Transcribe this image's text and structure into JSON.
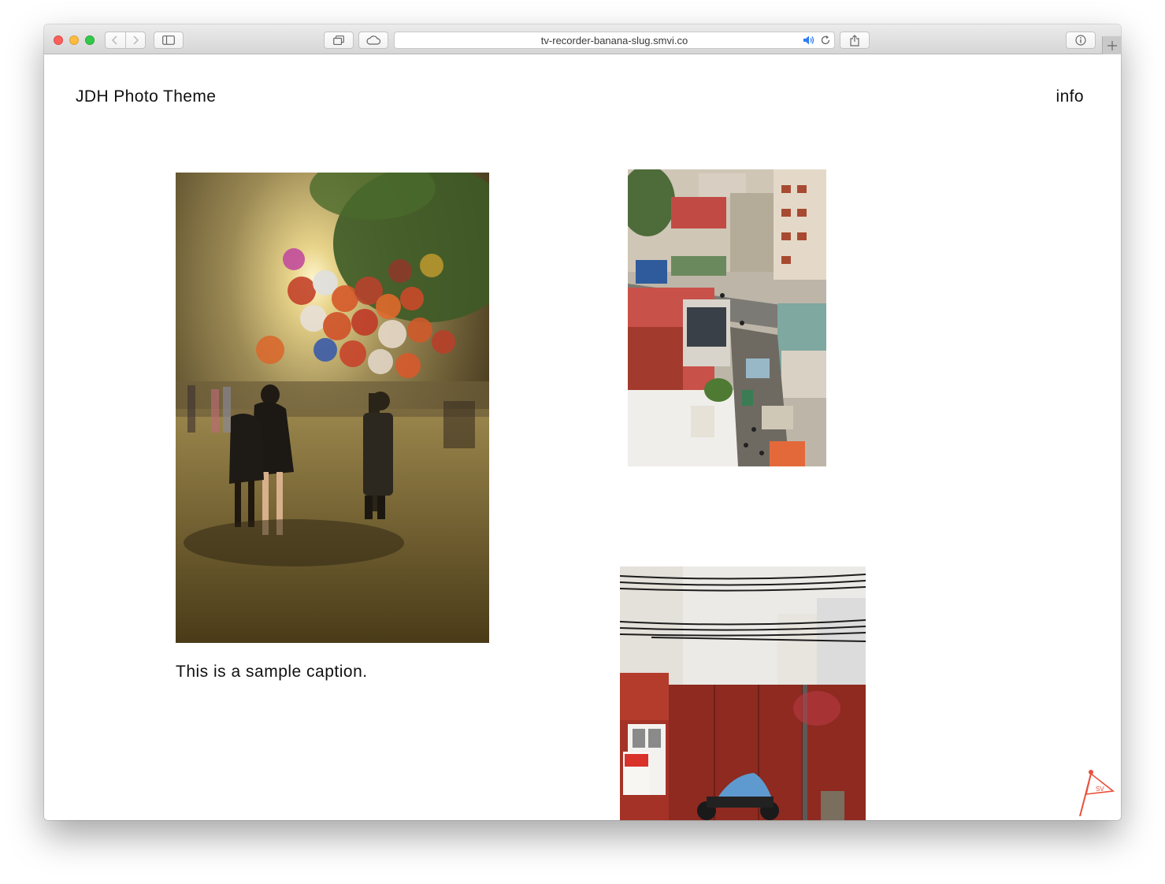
{
  "browser": {
    "address": "tv-recorder-banana-slug.smvi.co",
    "icons": [
      "back-icon",
      "forward-icon",
      "sidebar-icon",
      "tabs-icon",
      "icloud-icon",
      "speaker-icon",
      "reload-icon",
      "share-icon",
      "reader-icon",
      "plus-icon"
    ]
  },
  "site": {
    "title": "JDH Photo Theme",
    "nav_info": "info"
  },
  "photos": [
    {
      "description_icon": "balloon-vendor-photo",
      "caption": "This is a sample caption."
    },
    {
      "description_icon": "street-aerial-photo"
    },
    {
      "description_icon": "red-gate-photo"
    }
  ],
  "badge_icon": "flag-icon",
  "badge_text": "SV",
  "colors": {
    "accent": "#e8513d",
    "close": "#fc605c",
    "minimize": "#fdbc40",
    "zoom": "#34c84a"
  }
}
